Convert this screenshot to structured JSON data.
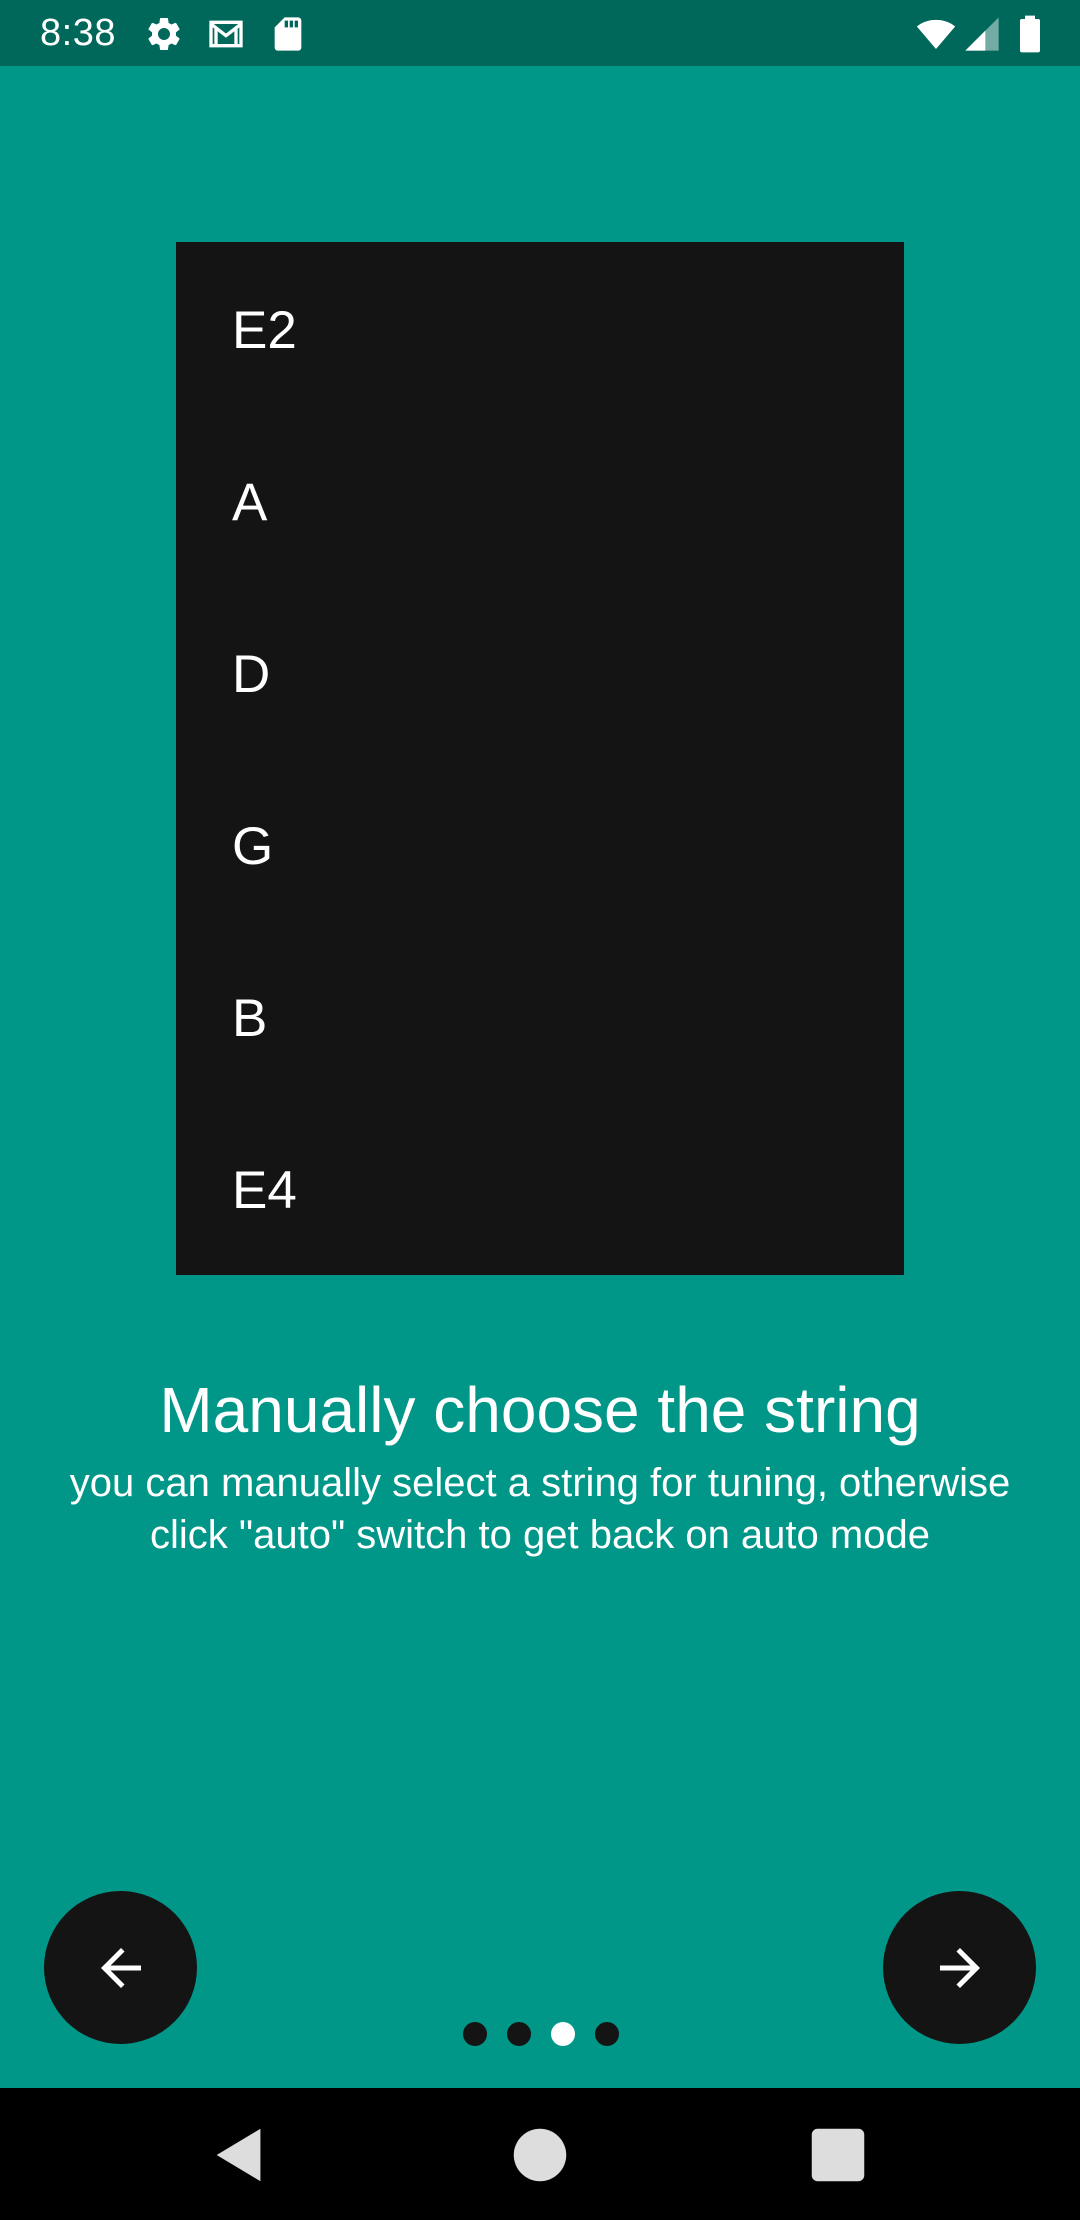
{
  "status_bar": {
    "time": "8:38",
    "icons": [
      "gear-icon",
      "gmail-icon",
      "sd-card-icon",
      "wifi-icon",
      "cellular-signal-icon",
      "battery-icon"
    ]
  },
  "tutorial": {
    "strings": [
      "E2",
      "A",
      "D",
      "G",
      "B",
      "E4"
    ],
    "title": "Manually choose the string",
    "description": "you can manually select a string for tuning, otherwise click \"auto\" switch to get back on auto mode",
    "current_page": 3,
    "total_pages": 4
  },
  "navigation": {
    "back_icon": "arrow-left-icon",
    "next_icon": "arrow-right-icon"
  },
  "system_nav": {
    "icons": [
      "back-triangle-icon",
      "home-circle-icon",
      "recents-square-icon"
    ]
  },
  "colors": {
    "background": "#009688",
    "status_bar": "#00675b",
    "panel": "#141414",
    "text": "#ffffff"
  }
}
